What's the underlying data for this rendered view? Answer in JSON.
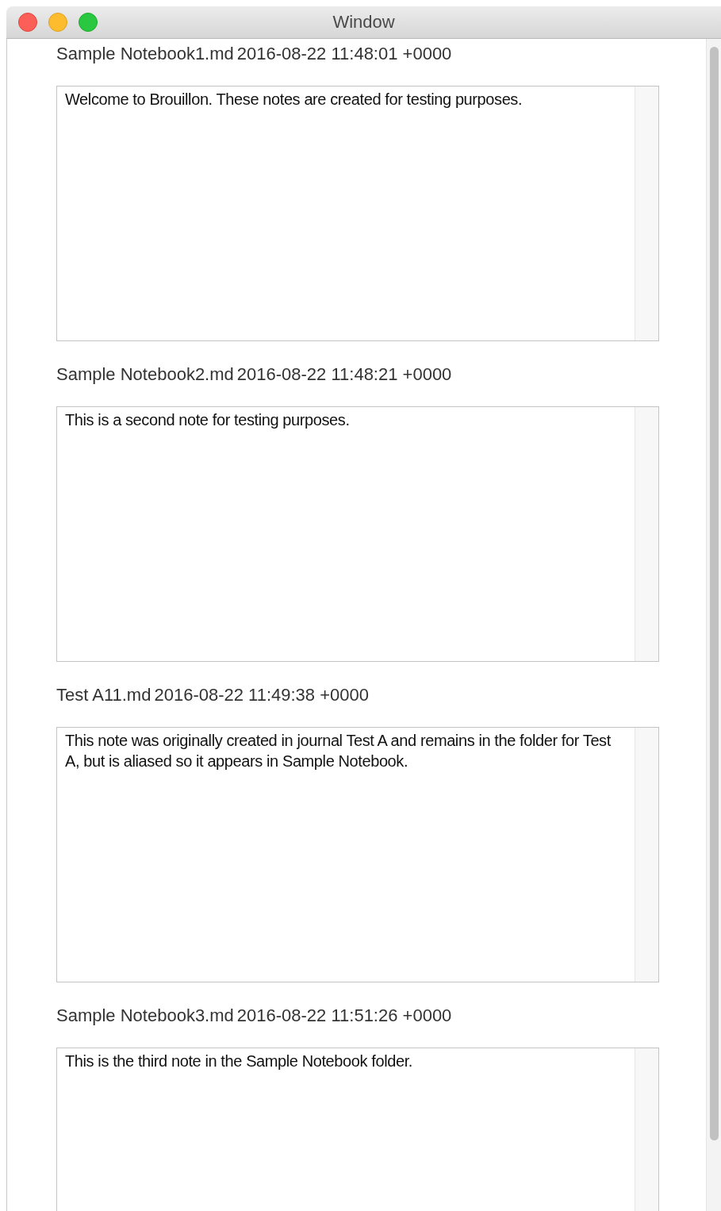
{
  "window": {
    "title": "Window"
  },
  "notes": [
    {
      "name": "Sample Notebook1.md",
      "date": "2016-08-22 11:48:01 +0000",
      "text": "Welcome to Brouillon. These notes are created for testing purposes."
    },
    {
      "name": "Sample Notebook2.md",
      "date": "2016-08-22 11:48:21 +0000",
      "text": "This is a second note for testing purposes."
    },
    {
      "name": "Test A11.md",
      "date": "2016-08-22 11:49:38 +0000",
      "text": "This note was originally created in journal Test A and remains in the folder for Test A, but is aliased so it appears in Sample Notebook."
    },
    {
      "name": "Sample Notebook3.md",
      "date": "2016-08-22 11:51:26 +0000",
      "text": "This is the third note in the Sample Notebook folder."
    }
  ]
}
